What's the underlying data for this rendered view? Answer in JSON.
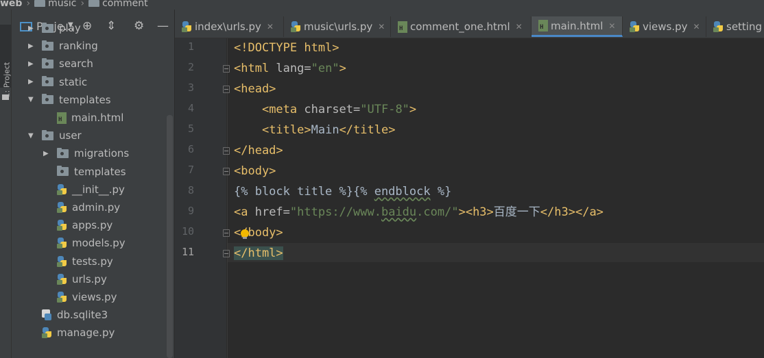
{
  "breadcrumb": [
    "web",
    "music",
    "comment"
  ],
  "sidestripe": {
    "label": "1: Project"
  },
  "project_panel": {
    "title": "Proje...",
    "tree": [
      {
        "label": "play",
        "kind": "folder",
        "depth": 0,
        "expanded": false
      },
      {
        "label": "ranking",
        "kind": "folder",
        "depth": 0,
        "expanded": false
      },
      {
        "label": "search",
        "kind": "folder",
        "depth": 0,
        "expanded": false
      },
      {
        "label": "static",
        "kind": "folder",
        "depth": 0,
        "expanded": false
      },
      {
        "label": "templates",
        "kind": "folder",
        "depth": 0,
        "expanded": true
      },
      {
        "label": "main.html",
        "kind": "html",
        "depth": 1
      },
      {
        "label": "user",
        "kind": "folder",
        "depth": 0,
        "expanded": true
      },
      {
        "label": "migrations",
        "kind": "folder",
        "depth": 1,
        "expanded": false
      },
      {
        "label": "templates",
        "kind": "folder",
        "depth": 1,
        "leaf": true
      },
      {
        "label": "__init__.py",
        "kind": "py",
        "depth": 1
      },
      {
        "label": "admin.py",
        "kind": "py",
        "depth": 1
      },
      {
        "label": "apps.py",
        "kind": "py",
        "depth": 1
      },
      {
        "label": "models.py",
        "kind": "py",
        "depth": 1
      },
      {
        "label": "tests.py",
        "kind": "py",
        "depth": 1
      },
      {
        "label": "urls.py",
        "kind": "py",
        "depth": 1
      },
      {
        "label": "views.py",
        "kind": "py",
        "depth": 1
      },
      {
        "label": "db.sqlite3",
        "kind": "db",
        "depth": 0
      },
      {
        "label": "manage.py",
        "kind": "py",
        "depth": 0
      }
    ]
  },
  "tabs": [
    {
      "label": "index\\urls.py",
      "kind": "py",
      "active": false
    },
    {
      "label": "music\\urls.py",
      "kind": "py",
      "active": false
    },
    {
      "label": "comment_one.html",
      "kind": "html",
      "active": false
    },
    {
      "label": "main.html",
      "kind": "html",
      "active": true
    },
    {
      "label": "views.py",
      "kind": "py",
      "active": false
    },
    {
      "label": "setting",
      "kind": "py",
      "active": false
    }
  ],
  "editor": {
    "line_numbers": [
      "1",
      "2",
      "3",
      "4",
      "5",
      "6",
      "7",
      "8",
      "9",
      "10",
      "11"
    ],
    "current_line": 11,
    "lines": [
      [
        {
          "t": "<!DOCTYPE html>",
          "c": "dt"
        }
      ],
      [
        {
          "t": "<html",
          "c": "tag"
        },
        {
          "t": " lang=",
          "c": "attr"
        },
        {
          "t": "\"en\"",
          "c": "str"
        },
        {
          "t": ">",
          "c": "tag"
        }
      ],
      [
        {
          "t": "<head>",
          "c": "tag"
        }
      ],
      [
        {
          "t": "    "
        },
        {
          "t": "<meta",
          "c": "tag"
        },
        {
          "t": " charset=",
          "c": "attr"
        },
        {
          "t": "\"UTF-8\"",
          "c": "str"
        },
        {
          "t": ">",
          "c": "tag"
        }
      ],
      [
        {
          "t": "    "
        },
        {
          "t": "<title>",
          "c": "tag"
        },
        {
          "t": "Main"
        },
        {
          "t": "</title>",
          "c": "tag"
        }
      ],
      [
        {
          "t": "</head>",
          "c": "tag"
        }
      ],
      [
        {
          "t": "<body>",
          "c": "tag"
        }
      ],
      [
        {
          "t": "{% block title %}{% "
        },
        {
          "t": "endblock",
          "c": "wavy"
        },
        {
          "t": " %}"
        }
      ],
      [
        {
          "t": "<a",
          "c": "tag"
        },
        {
          "t": " href=",
          "c": "attr"
        },
        {
          "t": "\"https://www.",
          "c": "str"
        },
        {
          "t": "baidu",
          "c": "str wavy"
        },
        {
          "t": ".com/\"",
          "c": "str"
        },
        {
          "t": ">",
          "c": "tag"
        },
        {
          "t": "<h3>",
          "c": "tag"
        },
        {
          "t": "百度一下"
        },
        {
          "t": "</h3>",
          "c": "tag"
        },
        {
          "t": "</a>",
          "c": "tag"
        }
      ],
      [
        {
          "t": "</body>",
          "c": "tag"
        }
      ],
      [
        {
          "t": "</html>",
          "c": "tag hl"
        }
      ]
    ]
  }
}
